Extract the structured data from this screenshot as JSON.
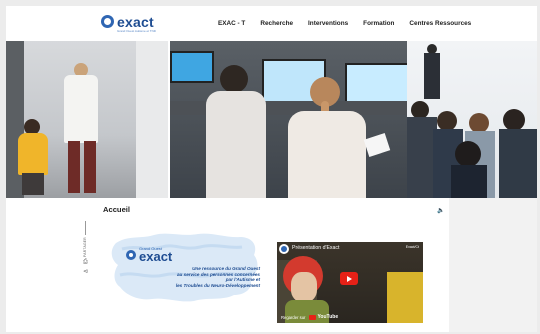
{
  "header": {
    "logo_text": "exact",
    "logo_tagline": "Grand Ouest Autisme et TND",
    "nav": [
      "EXAC - T",
      "Recherche",
      "Interventions",
      "Formation",
      "Centres Ressources"
    ]
  },
  "main": {
    "breadcrumb": "Accueil",
    "share_label": "PARTAGER",
    "map_card": {
      "brand": "exact",
      "brand_prefix": "Grand Ouest",
      "line1": "Une ressource du Grand Ouest",
      "line2": "au service des personnes concernées",
      "line3": "par l'Autisme et",
      "line4": "les Troubles du Neuro-Développement"
    },
    "video": {
      "title": "Présentation d'Exact",
      "channel": "Exact/Ct",
      "watch_on": "Regarder sur",
      "platform": "YouTube"
    }
  },
  "colors": {
    "brand": "#1f4d92",
    "accent": "#2f66b3",
    "youtube": "#e62117"
  }
}
